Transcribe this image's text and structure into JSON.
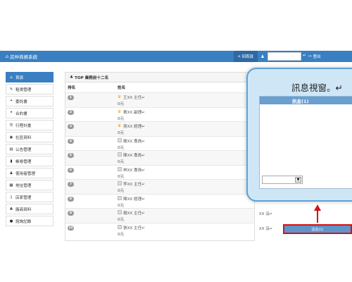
{
  "nav": {
    "brand": "房仲商務系統",
    "brand_icon": "home-icon",
    "home_label": "回首頁",
    "user_icon": "user-icon",
    "enter_glyph": "↵",
    "logout_label": "登出",
    "accent": "#3a7fc1"
  },
  "sidebar": {
    "items": [
      {
        "label": "首頁",
        "icon": "home-icon",
        "glyph": "⌂",
        "active": true
      },
      {
        "label": "租賃管理",
        "icon": "wrench-icon",
        "glyph": "✎",
        "active": false
      },
      {
        "label": "委託書",
        "icon": "quote-icon",
        "glyph": "❝",
        "active": false
      },
      {
        "label": "合約書",
        "icon": "quote-icon",
        "glyph": "❞",
        "active": false
      },
      {
        "label": "行程計畫",
        "icon": "list-icon",
        "glyph": "☰",
        "active": false
      },
      {
        "label": "社區資料",
        "icon": "globe-icon",
        "glyph": "◉",
        "active": false
      },
      {
        "label": "公告管理",
        "icon": "document-icon",
        "glyph": "▤",
        "active": false
      },
      {
        "label": "帳卷管理",
        "icon": "bookmark-icon",
        "glyph": "▮",
        "active": false
      },
      {
        "label": "使用者管理",
        "icon": "user-icon",
        "glyph": "♟",
        "active": false
      },
      {
        "label": "地址管理",
        "icon": "book-icon",
        "glyph": "▦",
        "active": false
      },
      {
        "label": "店家管理",
        "icon": "file-icon",
        "glyph": "▯",
        "active": false
      },
      {
        "label": "廠商資料",
        "icon": "users-icon",
        "glyph": "♣",
        "active": false
      },
      {
        "label": "諮詢記錄",
        "icon": "chat-icon",
        "glyph": "●",
        "active": false
      }
    ]
  },
  "ranking": {
    "title": "TOP 業務前十二名",
    "title_icon": "users-icon",
    "col_rank": "排名",
    "col_name": "姓名",
    "rows": [
      {
        "rank": "1",
        "name": "王XX 主任↵",
        "amount": "0元",
        "crown": true,
        "extra": ""
      },
      {
        "rank": "2",
        "name": "黃XX 副理↵",
        "amount": "0元",
        "crown": true,
        "extra": ""
      },
      {
        "rank": "3",
        "name": "吳XX 經理↵",
        "amount": "0元",
        "crown": true,
        "extra": ""
      },
      {
        "rank": "4",
        "name": "謝XX 專員↵",
        "amount": "0元",
        "crown": false,
        "extra": ""
      },
      {
        "rank": "5",
        "name": "陳XX 專員↵",
        "amount": "0元",
        "crown": false,
        "extra": ""
      },
      {
        "rank": "6",
        "name": "林XX 專員↵",
        "amount": "0元",
        "crown": false,
        "extra": ""
      },
      {
        "rank": "7",
        "name": "李XX 主任↵",
        "amount": "0元",
        "crown": false,
        "extra": ""
      },
      {
        "rank": "8",
        "name": "陳XX 經理↵",
        "amount": "0元",
        "crown": false,
        "extra": ""
      },
      {
        "rank": "9",
        "name": "楊XX 主任↵",
        "amount": "0元",
        "crown": false,
        "extra": "XX 沒↵"
      },
      {
        "rank": "10",
        "name": "張XX 主任↵",
        "amount": "0元",
        "crown": false,
        "extra": "XX 沒↵"
      }
    ]
  },
  "popup": {
    "title": "訊息視窗。↵",
    "inner_title": "訊息(1)",
    "select_text": "",
    "select_arrow": "▼",
    "bg_color": "#cfe6f7",
    "border_color": "#5aa3d9"
  },
  "message_tab": {
    "label": "訊息(1)"
  },
  "annotation_color": "#d01515"
}
